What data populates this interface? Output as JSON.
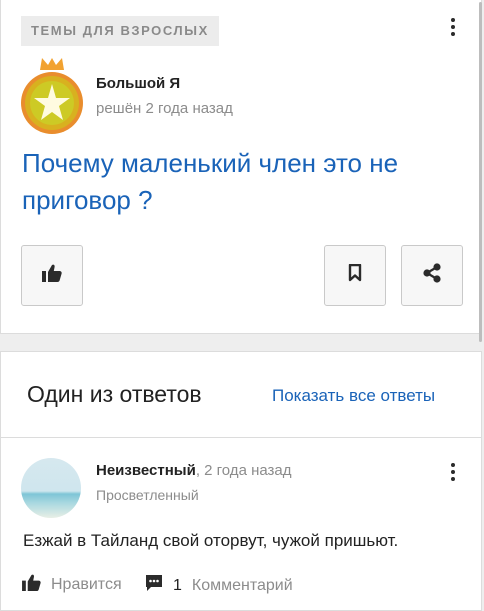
{
  "question": {
    "topic_badge": "ТЕМЫ ДЛЯ ВЗРОСЛЫХ",
    "author": {
      "name": "Большой Я",
      "meta": "решён 2 года назад"
    },
    "title": "Почему маленький член это не приговор ?",
    "buttons": {
      "like_icon": "thumbs-up-icon",
      "bookmark_icon": "bookmark-icon",
      "share_icon": "share-icon"
    }
  },
  "answers": {
    "heading": "Один из ответов",
    "show_all": "Показать все ответы",
    "top_answer": {
      "author_name": "Неизвестный",
      "time": ", 2 года назад",
      "rank": "Просветленный",
      "text": "Езжай в Тайланд свой оторвут, чужой пришьют.",
      "like_label": "Нравится",
      "comment_count": "1",
      "comment_label": "Комментарий"
    }
  },
  "colors": {
    "accent": "#1a63b8",
    "muted": "#8c8c8c"
  }
}
